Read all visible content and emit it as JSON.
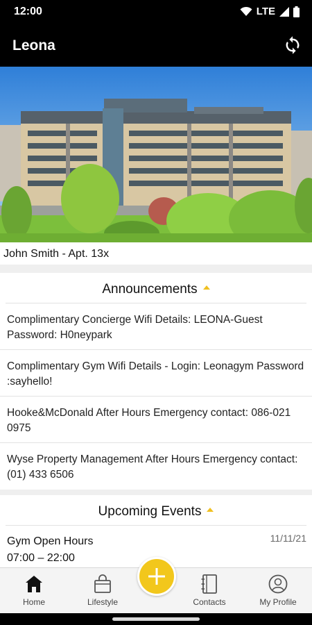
{
  "status_bar": {
    "time": "12:00",
    "network": "LTE",
    "icons": [
      "wifi-icon",
      "signal-icon",
      "battery-icon"
    ]
  },
  "app_bar": {
    "title": "Leona",
    "refresh_icon": "refresh-icon"
  },
  "resident": {
    "label": "John Smith - Apt. 13x"
  },
  "announcements": {
    "title": "Announcements",
    "items": [
      {
        "text": "Complimentary Concierge Wifi Details: LEONA-Guest Password: H0neypark"
      },
      {
        "text": "Complimentary Gym Wifi Details - Login: Leonagym Password :sayhello!"
      },
      {
        "text": "Hooke&McDonald After Hours Emergency contact: 086-021 0975"
      },
      {
        "text": "Wyse Property Management After Hours Emergency contact: (01) 433 6506"
      }
    ]
  },
  "events": {
    "title": "Upcoming Events",
    "items": [
      {
        "name": "Gym Open Hours",
        "time": "07:00 – 22:00",
        "date": "11/11/21"
      }
    ]
  },
  "bottom_nav": {
    "items": [
      {
        "label": "Home",
        "icon": "home-icon"
      },
      {
        "label": "Lifestyle",
        "icon": "shopping-bag-icon"
      },
      {
        "label": "Contacts",
        "icon": "contacts-book-icon"
      },
      {
        "label": "My Profile",
        "icon": "profile-icon"
      }
    ],
    "fab_icon": "plus-icon"
  },
  "colors": {
    "accent": "#f2c71c",
    "app_bar": "#000000",
    "background": "#efefef"
  }
}
